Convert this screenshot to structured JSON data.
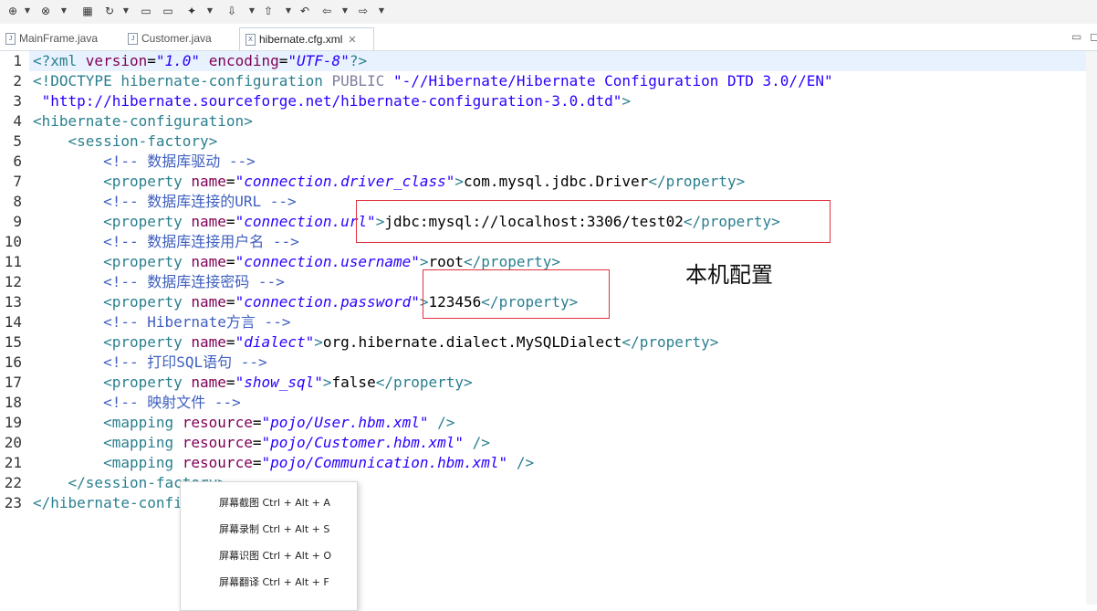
{
  "toolbar": {
    "buttons": [
      {
        "name": "new-server-icon",
        "glyph": "⊕"
      },
      {
        "name": "debug-server-icon",
        "glyph": "⊗"
      },
      {
        "name": "package-icon",
        "glyph": "▦"
      },
      {
        "name": "refresh-icon",
        "glyph": "↻"
      },
      {
        "name": "open-folder-icon",
        "glyph": "▭"
      },
      {
        "name": "folder-icon",
        "glyph": "▭"
      },
      {
        "name": "wand-icon",
        "glyph": "✦"
      },
      {
        "name": "next-annotation-icon",
        "glyph": "⇩"
      },
      {
        "name": "prev-annotation-icon",
        "glyph": "⇧"
      },
      {
        "name": "last-edit-icon",
        "glyph": "↶"
      },
      {
        "name": "back-icon",
        "glyph": "⇦"
      },
      {
        "name": "forward-icon",
        "glyph": "⇨"
      }
    ]
  },
  "tabs": [
    {
      "label": "MainFrame.java",
      "icon": "java-file-icon",
      "active": false
    },
    {
      "label": "Customer.java",
      "icon": "java-file-icon",
      "active": false
    },
    {
      "label": "hibernate.cfg.xml",
      "icon": "xml-file-icon",
      "active": true,
      "close": "✕"
    }
  ],
  "editor": {
    "line_numbers": [
      "1",
      "2",
      "3",
      "4",
      "5",
      "6",
      "7",
      "8",
      "9",
      "10",
      "11",
      "12",
      "13",
      "14",
      "15",
      "16",
      "17",
      "18",
      "19",
      "20",
      "21",
      "22",
      "23"
    ],
    "lines": [
      [
        [
          "t-tag",
          "<?xml "
        ],
        [
          "t-attr",
          "version"
        ],
        [
          "t-txt",
          "="
        ],
        [
          "t-str",
          "\"1.0\""
        ],
        [
          "t-txt",
          " "
        ],
        [
          "t-attr",
          "encoding"
        ],
        [
          "t-txt",
          "="
        ],
        [
          "t-str",
          "\"UTF-8\""
        ],
        [
          "t-tag",
          "?>"
        ]
      ],
      [
        [
          "t-dt",
          "<!DOCTYPE hibernate-configuration "
        ],
        [
          "t-pub",
          "PUBLIC "
        ],
        [
          "t-dtstr",
          "\"-//Hibernate/Hibernate Configuration DTD 3.0//EN\""
        ]
      ],
      [
        [
          "t-dtstr",
          " \"http://hibernate.sourceforge.net/hibernate-configuration-3.0.dtd\""
        ],
        [
          "t-dt",
          ">"
        ]
      ],
      [
        [
          "t-tag",
          "<hibernate-configuration>"
        ]
      ],
      [
        [
          "t-tag",
          "    <session-factory>"
        ]
      ],
      [
        [
          "t-cmt",
          "        <!-- 数据库驱动 -->"
        ]
      ],
      [
        [
          "t-tag",
          "        <property "
        ],
        [
          "t-attr",
          "name"
        ],
        [
          "t-txt",
          "="
        ],
        [
          "t-str",
          "\"connection.driver_class\""
        ],
        [
          "t-tag",
          ">"
        ],
        [
          "t-txt",
          "com.mysql.jdbc.Driver"
        ],
        [
          "t-tag",
          "</property>"
        ]
      ],
      [
        [
          "t-cmt",
          "        <!-- 数据库连接的URL -->"
        ]
      ],
      [
        [
          "t-tag",
          "        <property "
        ],
        [
          "t-attr",
          "name"
        ],
        [
          "t-txt",
          "="
        ],
        [
          "t-str",
          "\"connection.url\""
        ],
        [
          "t-tag",
          ">"
        ],
        [
          "t-txt",
          "jdbc:mysql://localhost:3306/test02"
        ],
        [
          "t-tag",
          "</property>"
        ]
      ],
      [
        [
          "t-cmt",
          "        <!-- 数据库连接用户名 -->"
        ]
      ],
      [
        [
          "t-tag",
          "        <property "
        ],
        [
          "t-attr",
          "name"
        ],
        [
          "t-txt",
          "="
        ],
        [
          "t-str",
          "\"connection.username\""
        ],
        [
          "t-tag",
          ">"
        ],
        [
          "t-txt",
          "root"
        ],
        [
          "t-tag",
          "</property>"
        ]
      ],
      [
        [
          "t-cmt",
          "        <!-- 数据库连接密码 -->"
        ]
      ],
      [
        [
          "t-tag",
          "        <property "
        ],
        [
          "t-attr",
          "name"
        ],
        [
          "t-txt",
          "="
        ],
        [
          "t-str",
          "\"connection.password\""
        ],
        [
          "t-tag",
          ">"
        ],
        [
          "t-txt",
          "123456"
        ],
        [
          "t-tag",
          "</property>"
        ]
      ],
      [
        [
          "t-cmt",
          "        <!-- Hibernate方言 -->"
        ]
      ],
      [
        [
          "t-tag",
          "        <property "
        ],
        [
          "t-attr",
          "name"
        ],
        [
          "t-txt",
          "="
        ],
        [
          "t-str",
          "\"dialect\""
        ],
        [
          "t-tag",
          ">"
        ],
        [
          "t-txt",
          "org.hibernate.dialect.MySQLDialect"
        ],
        [
          "t-tag",
          "</property>"
        ]
      ],
      [
        [
          "t-cmt",
          "        <!-- 打印SQL语句 -->"
        ]
      ],
      [
        [
          "t-tag",
          "        <property "
        ],
        [
          "t-attr",
          "name"
        ],
        [
          "t-txt",
          "="
        ],
        [
          "t-str",
          "\"show_sql\""
        ],
        [
          "t-tag",
          ">"
        ],
        [
          "t-txt",
          "false"
        ],
        [
          "t-tag",
          "</property>"
        ]
      ],
      [
        [
          "t-cmt",
          "        <!-- 映射文件 -->"
        ]
      ],
      [
        [
          "t-tag",
          "        <mapping "
        ],
        [
          "t-attr",
          "resource"
        ],
        [
          "t-txt",
          "="
        ],
        [
          "t-str",
          "\"pojo/User.hbm.xml\""
        ],
        [
          "t-tag",
          " />"
        ]
      ],
      [
        [
          "t-tag",
          "        <mapping "
        ],
        [
          "t-attr",
          "resource"
        ],
        [
          "t-txt",
          "="
        ],
        [
          "t-str",
          "\"pojo/Customer.hbm.xml\""
        ],
        [
          "t-tag",
          " />"
        ]
      ],
      [
        [
          "t-tag",
          "        <mapping "
        ],
        [
          "t-attr",
          "resource"
        ],
        [
          "t-txt",
          "="
        ],
        [
          "t-str",
          "\"pojo/Communication.hbm.xml\""
        ],
        [
          "t-tag",
          " />"
        ]
      ],
      [
        [
          "t-tag",
          "    </session-factory>"
        ]
      ],
      [
        [
          "t-tag",
          "</hibernate-configuration>"
        ]
      ]
    ]
  },
  "annotation": {
    "text": "本机配置"
  },
  "context_menu": {
    "items": [
      "屏幕截图 Ctrl + Alt + A",
      "屏幕录制 Ctrl + Alt + S",
      "屏幕识图 Ctrl + Alt + O",
      "屏幕翻译 Ctrl + Alt + F"
    ]
  },
  "window_controls": {
    "minimize": "▭",
    "restore": "◻"
  }
}
